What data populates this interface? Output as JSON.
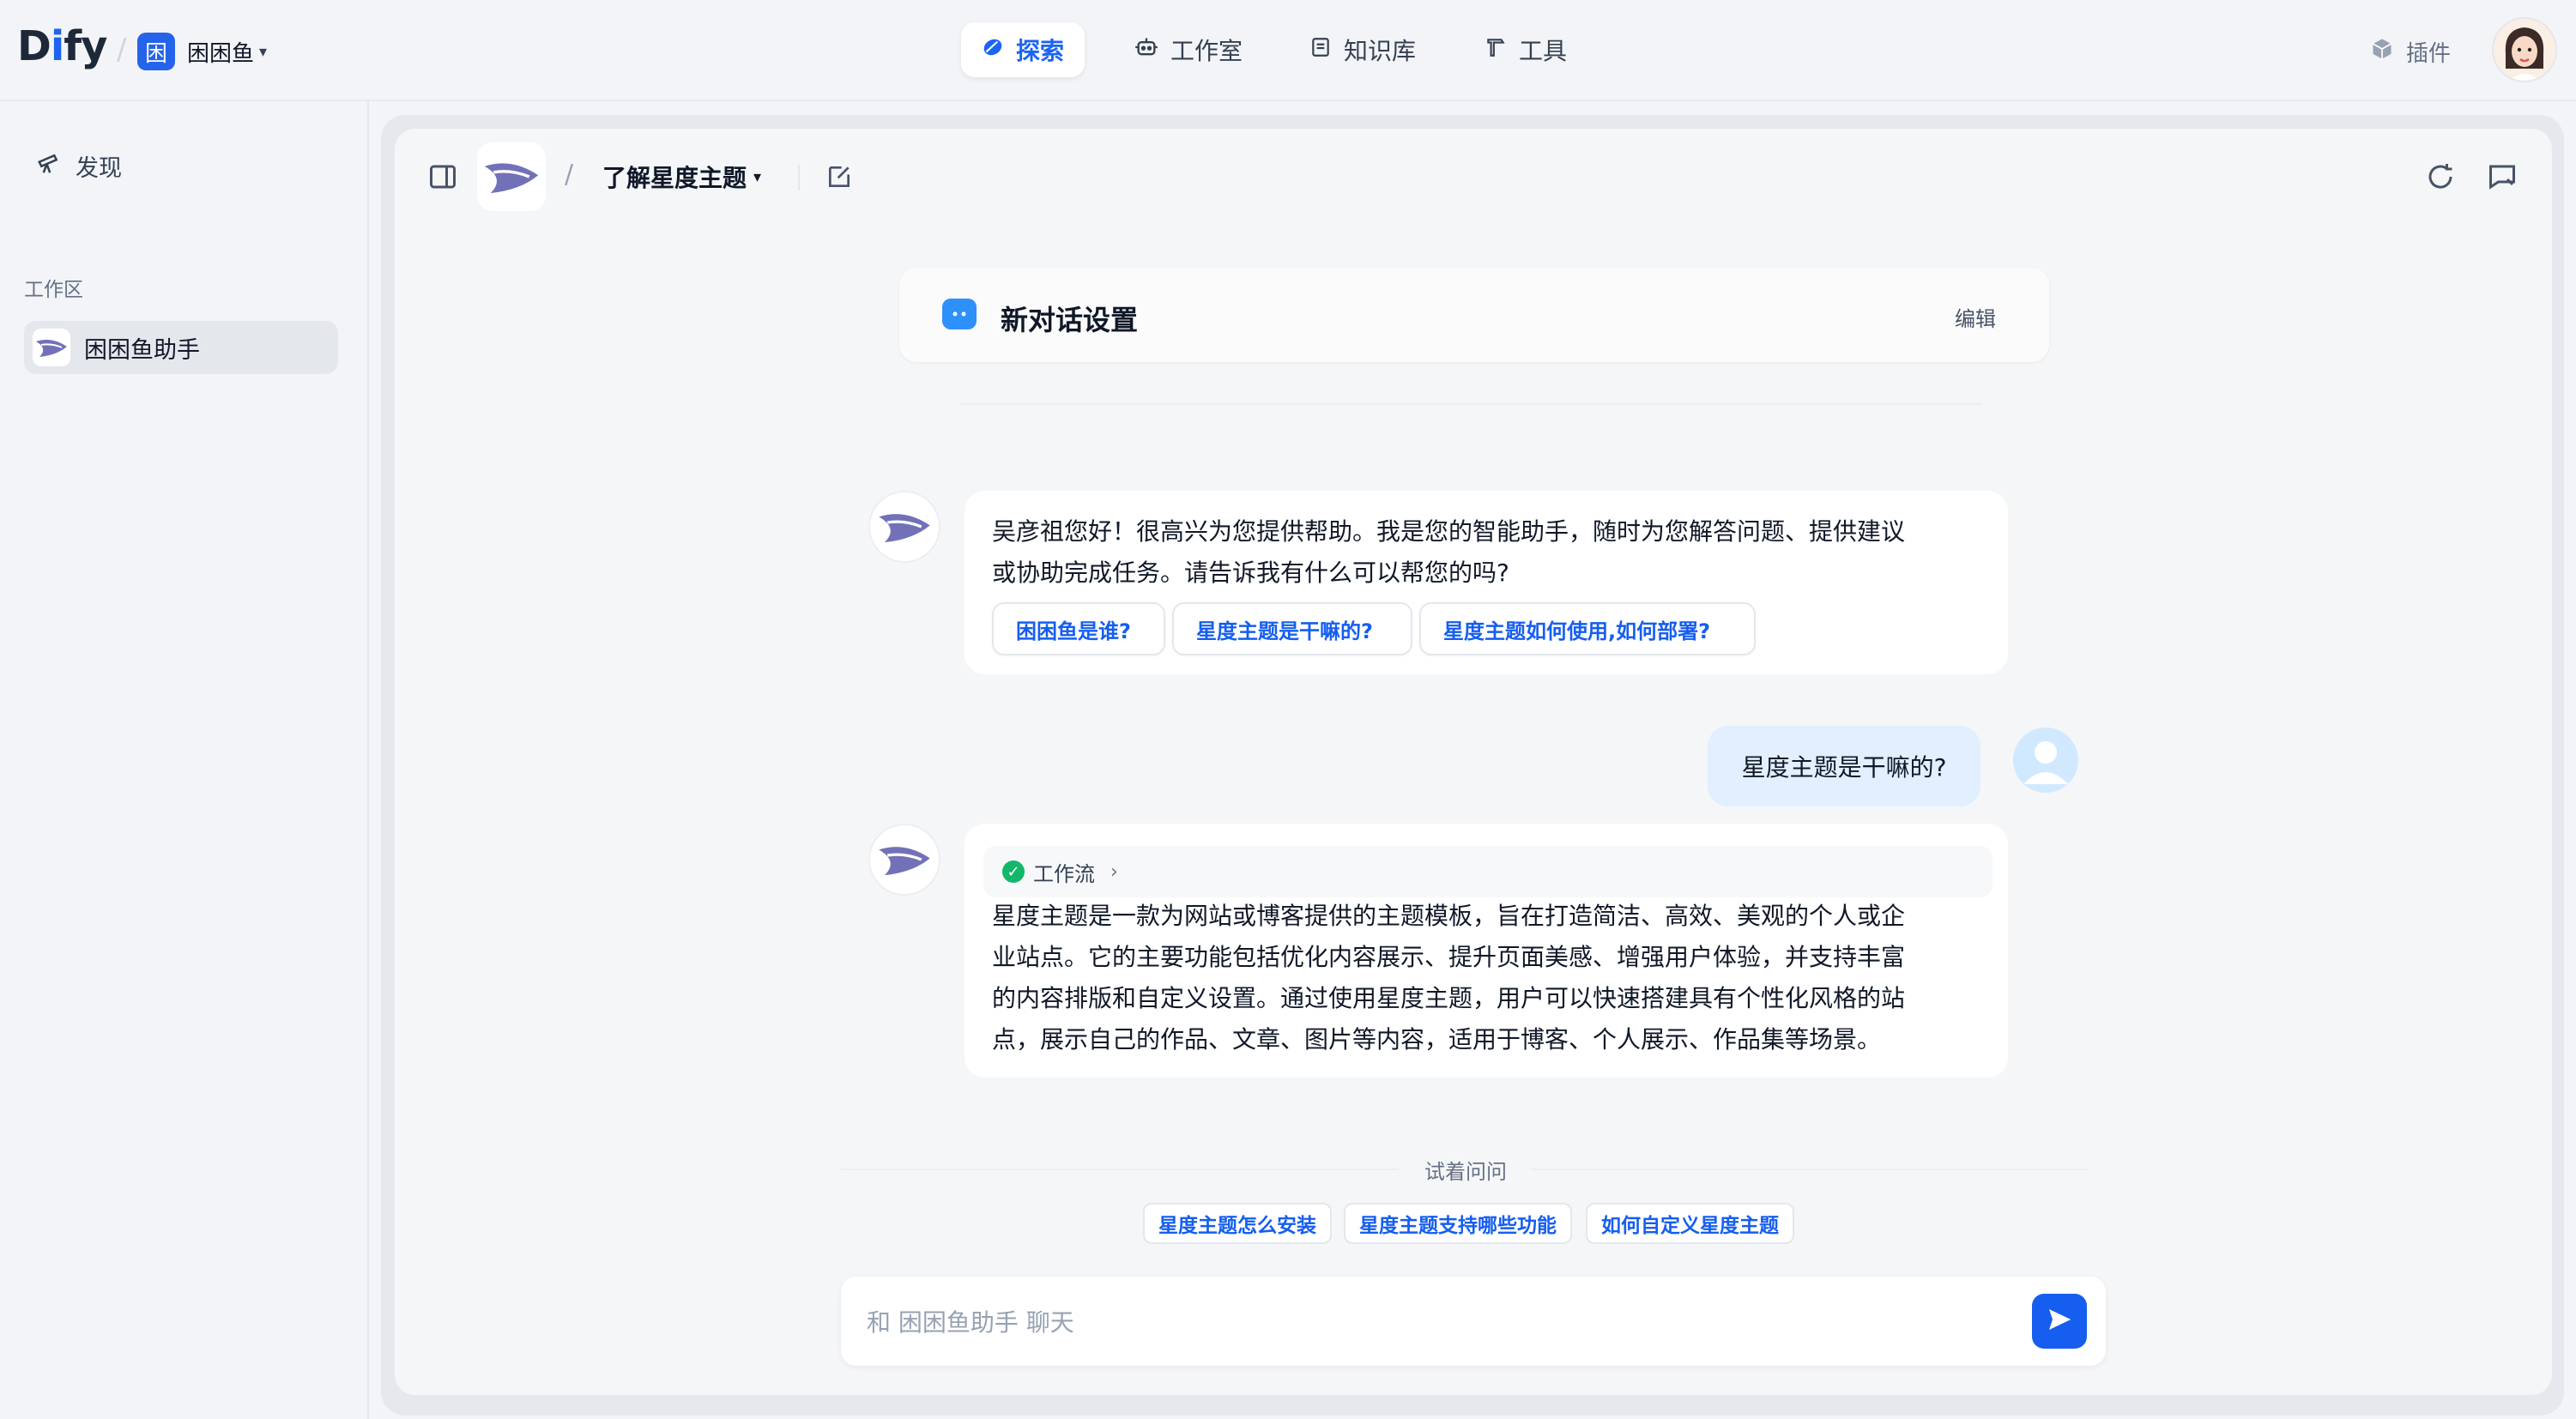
{
  "topbar": {
    "logo": "Dify",
    "workspace": {
      "badge": "困",
      "name": "困困鱼"
    },
    "nav": [
      {
        "label": "探索",
        "icon": "compass-icon",
        "active": true
      },
      {
        "label": "工作室",
        "icon": "robot-icon",
        "active": false
      },
      {
        "label": "知识库",
        "icon": "book-icon",
        "active": false
      },
      {
        "label": "工具",
        "icon": "hammer-icon",
        "active": false
      }
    ],
    "plugins_label": "插件"
  },
  "sidebar": {
    "discover_label": "发现",
    "section_title": "工作区",
    "apps": [
      {
        "label": "困困鱼助手"
      }
    ]
  },
  "chat_header": {
    "title": "了解星度主题"
  },
  "settings_card": {
    "title": "新对话设置",
    "edit_label": "编辑"
  },
  "messages": [
    {
      "role": "assistant",
      "lines": [
        "吴彦祖您好！很高兴为您提供帮助。我是您的智能助手，随时为您解答问题、提供建议",
        "或协助完成任务。请告诉我有什么可以帮您的吗?"
      ],
      "suggestions": [
        "困困鱼是谁?",
        "星度主题是干嘛的?",
        "星度主题如何使用,如何部署?"
      ]
    },
    {
      "role": "user",
      "text": "星度主题是干嘛的?"
    },
    {
      "role": "assistant",
      "workflow_label": "工作流",
      "lines": [
        "星度主题是一款为网站或博客提供的主题模板，旨在打造简洁、高效、美观的个人或企",
        "业站点。它的主要功能包括优化内容展示、提升页面美感、增强用户体验，并支持丰富",
        "的内容排版和自定义设置。通过使用星度主题，用户可以快速搭建具有个性化风格的站",
        "点，展示自己的作品、文章、图片等内容，适用于博客、个人展示、作品集等场景。"
      ]
    }
  ],
  "try_ask": {
    "label": "试着问问",
    "chips": [
      "星度主题怎么安装",
      "星度主题支持哪些功能",
      "如何自定义星度主题"
    ]
  },
  "input": {
    "placeholder": "和 困困鱼助手 聊天",
    "value": ""
  },
  "colors": {
    "accent": "#155eef",
    "user_bubble": "#e1effe",
    "background": "#f2f4f7"
  }
}
